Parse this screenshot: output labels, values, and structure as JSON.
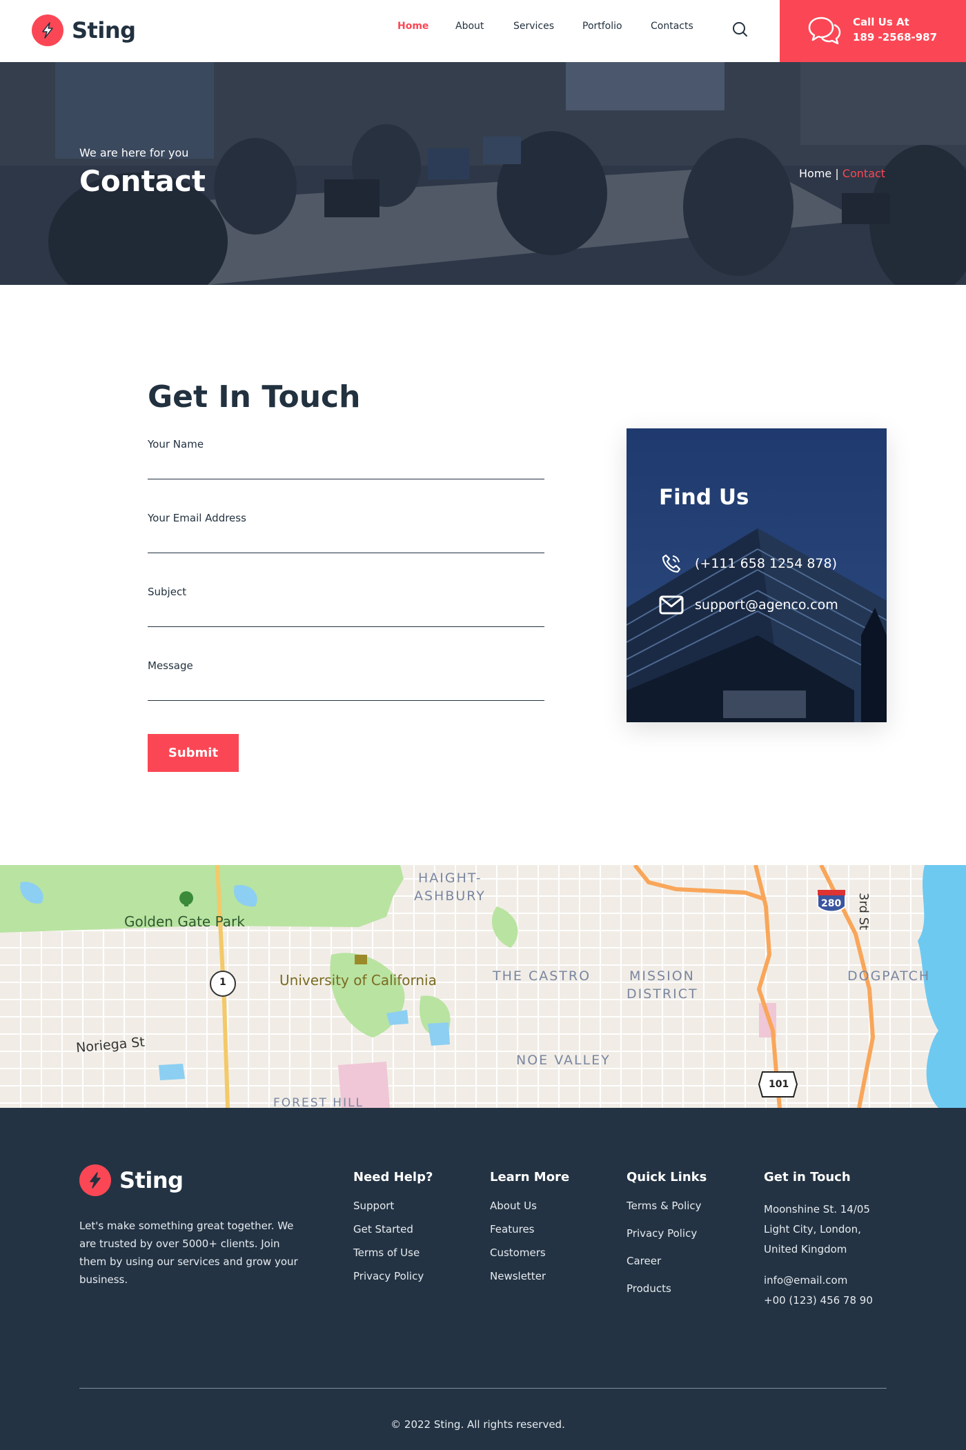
{
  "brand": {
    "name": "Sting",
    "accent": "#fb4755",
    "dark": "#233343"
  },
  "nav": {
    "items": [
      {
        "label": "Home",
        "active": true
      },
      {
        "label": "About",
        "active": false
      },
      {
        "label": "Services",
        "active": false
      },
      {
        "label": "Portfolio",
        "active": false
      },
      {
        "label": "Contacts",
        "active": false
      }
    ],
    "search_icon": "search-icon"
  },
  "call": {
    "title": "Call Us At",
    "phone": "189 -2568-987",
    "icon": "chat-bubbles-icon"
  },
  "hero": {
    "subtitle": "We are here for you",
    "title": "Contact",
    "breadcrumb": {
      "home": "Home",
      "separator": " | ",
      "current": "Contact"
    }
  },
  "form": {
    "title": "Get In Touch",
    "fields": [
      {
        "label": "Your Name",
        "value": ""
      },
      {
        "label": "Your Email Address",
        "value": ""
      },
      {
        "label": "Subject",
        "value": ""
      },
      {
        "label": "Message",
        "value": ""
      }
    ],
    "submit_label": "Submit"
  },
  "find_us": {
    "title": "Find Us",
    "phone": "(+111 658 1254 878)",
    "email": "support@agenco.com",
    "phone_icon": "phone-icon",
    "email_icon": "envelope-icon"
  },
  "map": {
    "labels": [
      {
        "text": "Golden Gate Park"
      },
      {
        "text": "HAIGHT-"
      },
      {
        "text": "ASHBURY"
      },
      {
        "text": "University of California"
      },
      {
        "text": "THE CASTRO"
      },
      {
        "text": "MISSION"
      },
      {
        "text": "DISTRICT"
      },
      {
        "text": "DOGPATCH"
      },
      {
        "text": "3rd St"
      },
      {
        "text": "Noriega St"
      },
      {
        "text": "NOE VALLEY"
      },
      {
        "text": "FOREST HILL"
      }
    ],
    "shields": [
      "1",
      "280",
      "101"
    ]
  },
  "footer": {
    "about": "Let's make something great together. We are trusted by over 5000+ clients. Join them by using our services and grow your business.",
    "columns": [
      {
        "title": "Need Help?",
        "links": [
          "Support",
          "Get Started",
          "Terms of Use",
          "Privacy Policy"
        ]
      },
      {
        "title": "Learn More",
        "links": [
          "About Us",
          "Features",
          "Customers",
          "Newsletter"
        ]
      },
      {
        "title": "Quick Links",
        "links": [
          "Terms & Policy",
          "Privacy Policy",
          "Career",
          "Products"
        ]
      }
    ],
    "contact": {
      "title": "Get in Touch",
      "address": [
        "Moonshine St. 14/05",
        "Light City, London,",
        "United Kingdom"
      ],
      "email": "info@email.com",
      "phone": "+00 (123) 456 78 90"
    },
    "copyright": "© 2022 Sting. All rights reserved."
  }
}
